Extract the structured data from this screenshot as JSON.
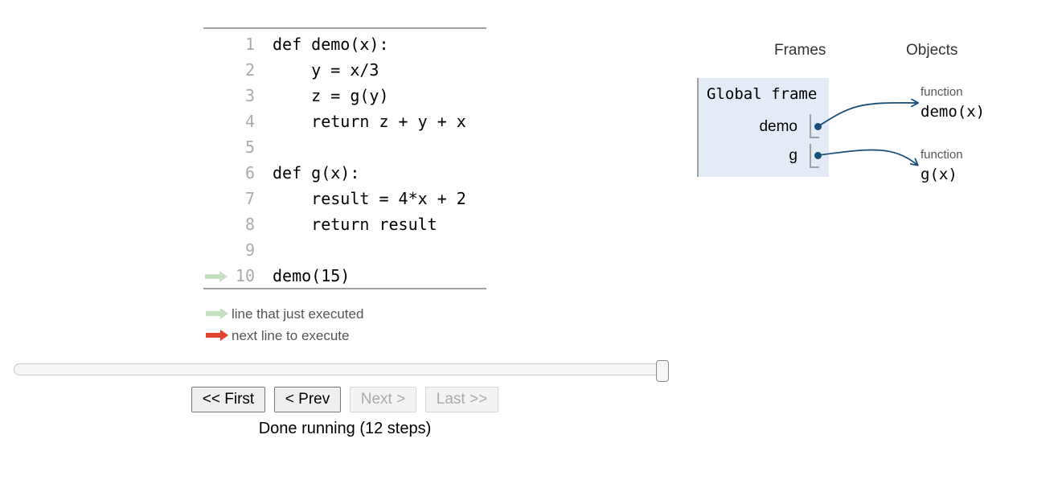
{
  "code": {
    "lines": [
      {
        "num": "1",
        "text": "def demo(x):"
      },
      {
        "num": "2",
        "text": "    y = x/3"
      },
      {
        "num": "3",
        "text": "    z = g(y)"
      },
      {
        "num": "4",
        "text": "    return z + y + x"
      },
      {
        "num": "5",
        "text": ""
      },
      {
        "num": "6",
        "text": "def g(x):"
      },
      {
        "num": "7",
        "text": "    result = 4*x + 2"
      },
      {
        "num": "8",
        "text": "    return result"
      },
      {
        "num": "9",
        "text": ""
      },
      {
        "num": "10",
        "text": "demo(15)"
      }
    ],
    "executed_line": "10"
  },
  "legend": {
    "executed_label": "line that just executed",
    "next_label": "next line to execute",
    "executed_color": "#c5e0c0",
    "next_color": "#e0432e"
  },
  "slider": {
    "current_step": 12,
    "total_steps": 12
  },
  "controls": {
    "first_label": "<< First",
    "prev_label": "< Prev",
    "next_label": "Next >",
    "last_label": "Last >>",
    "status": "Done running (12 steps)"
  },
  "frames": {
    "header": "Frames",
    "global_frame": {
      "title": "Global frame",
      "vars": [
        {
          "name": "demo"
        },
        {
          "name": "g"
        }
      ]
    }
  },
  "objects": {
    "header": "Objects",
    "items": [
      {
        "type": "function",
        "value": "demo(x)"
      },
      {
        "type": "function",
        "value": "g(x)"
      }
    ]
  },
  "colors": {
    "frame_bg": "#e2ebf6",
    "pointer": "#1a4f7a"
  }
}
